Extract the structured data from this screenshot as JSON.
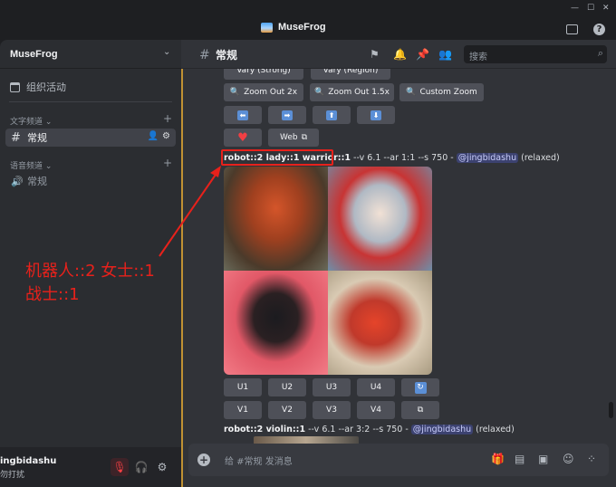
{
  "titlebar": {
    "app_name": "MuseFrog",
    "window_controls": [
      "—",
      "☐",
      "✕"
    ]
  },
  "sidebar": {
    "server_name": "MuseFrog",
    "events_label": "组织活动",
    "text_category": "文字频道",
    "text_channel": "常规",
    "voice_category": "语音频道",
    "voice_channel": "常规"
  },
  "user_panel": {
    "username": "ingbidashu",
    "status": "勿打扰"
  },
  "chat": {
    "channel_name": "常规",
    "search_placeholder": "搜索",
    "top_buttons": [
      "Vary (Strong)",
      "Vary (Region)"
    ],
    "zoom_buttons": [
      "Zoom Out 2x",
      "Zoom Out 1.5x",
      "Custom Zoom"
    ],
    "pan_arrows": [
      "⬅",
      "➡",
      "⬆",
      "⬇"
    ],
    "web_button": "Web",
    "message1": {
      "prompt": "robot::2 lady::1 warrior::1",
      "params": " --v 6.1 --ar 1:1 --s 750 - ",
      "mention": "@jingbidashu",
      "mode": " (relaxed)"
    },
    "upscale_buttons": [
      "U1",
      "U2",
      "U3",
      "U4"
    ],
    "variation_buttons": [
      "V1",
      "V2",
      "V3",
      "V4"
    ],
    "message2": {
      "prompt": "robot::2 violin::1",
      "params": " --v 6.1 --ar 3:2 --s 750 - ",
      "mention": "@jingbidashu",
      "mode": " (relaxed)"
    },
    "composer_placeholder": "给 #常规 发消息"
  },
  "annotation": {
    "line1": "机器人::2 女士::1",
    "line2": "战士::1",
    "color": "#e8211b"
  },
  "colors": {
    "accent": "#f0b232",
    "button": "#4e5058",
    "mention": "#3c4270"
  }
}
